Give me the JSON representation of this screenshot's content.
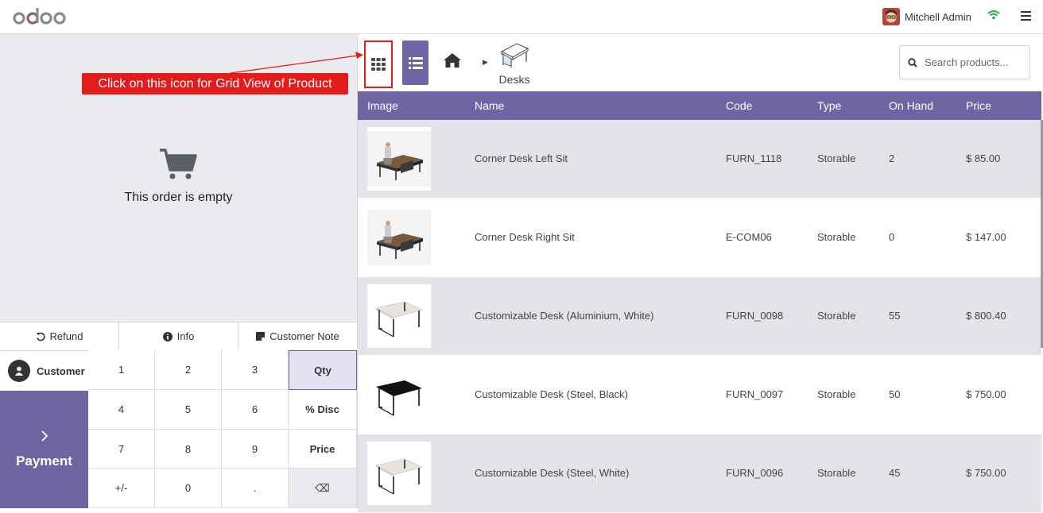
{
  "app": {
    "logo": "odoo",
    "user_name": "Mitchell Admin",
    "icons": [
      "wifi-icon",
      "menu-icon"
    ]
  },
  "order": {
    "empty_text": "This order is empty"
  },
  "controls": {
    "refund": "Refund",
    "info": "Info",
    "customer_note": "Customer Note"
  },
  "customer": {
    "label": "Customer"
  },
  "payment": {
    "label": "Payment"
  },
  "keypad": [
    {
      "label": "1",
      "type": "num"
    },
    {
      "label": "2",
      "type": "num"
    },
    {
      "label": "3",
      "type": "num"
    },
    {
      "label": "Qty",
      "type": "fn",
      "active": true
    },
    {
      "label": "4",
      "type": "num"
    },
    {
      "label": "5",
      "type": "num"
    },
    {
      "label": "6",
      "type": "num"
    },
    {
      "label": "% Disc",
      "type": "fn"
    },
    {
      "label": "7",
      "type": "num"
    },
    {
      "label": "8",
      "type": "num"
    },
    {
      "label": "9",
      "type": "num"
    },
    {
      "label": "Price",
      "type": "fn"
    },
    {
      "label": "+/-",
      "type": "num"
    },
    {
      "label": "0",
      "type": "num"
    },
    {
      "label": ".",
      "type": "num"
    },
    {
      "label": "⌫",
      "type": "back"
    }
  ],
  "breadcrumb": {
    "category": "Desks"
  },
  "search": {
    "placeholder": "Search products..."
  },
  "table": {
    "headers": [
      "Image",
      "Name",
      "Code",
      "Type",
      "On Hand",
      "Price"
    ],
    "rows": [
      {
        "name": "Corner Desk Left Sit",
        "code": "FURN_1118",
        "type": "Storable",
        "on_hand": "2",
        "price": "$ 85.00",
        "thumb": "office-desk-dark"
      },
      {
        "name": "Corner Desk Right Sit",
        "code": "E-COM06",
        "type": "Storable",
        "on_hand": "0",
        "price": "$ 147.00",
        "thumb": "office-desk-dark"
      },
      {
        "name": "Customizable Desk (Aluminium, White)",
        "code": "FURN_0098",
        "type": "Storable",
        "on_hand": "55",
        "price": "$ 800.40",
        "thumb": "desk-white"
      },
      {
        "name": "Customizable Desk (Steel, Black)",
        "code": "FURN_0097",
        "type": "Storable",
        "on_hand": "50",
        "price": "$ 750.00",
        "thumb": "desk-black"
      },
      {
        "name": "Customizable Desk (Steel, White)",
        "code": "FURN_0096",
        "type": "Storable",
        "on_hand": "45",
        "price": "$ 750.00",
        "thumb": "desk-white"
      }
    ]
  },
  "annotation": {
    "text": "Click on this icon for Grid View of Product"
  },
  "colors": {
    "accent": "#7064a3",
    "annotation": "#e21b1b",
    "row_shade": "#e3e4e9"
  }
}
